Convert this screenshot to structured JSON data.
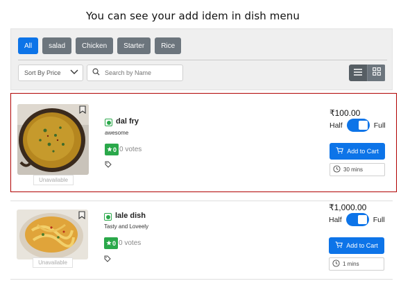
{
  "caption": "You can see your add idem in dish menu",
  "filters": {
    "categories": [
      {
        "label": "All",
        "active": true
      },
      {
        "label": "salad",
        "active": false
      },
      {
        "label": "Chicken",
        "active": false
      },
      {
        "label": "Starter",
        "active": false
      },
      {
        "label": "Rice",
        "active": false
      }
    ],
    "sort_label": "Sort By Price",
    "search_placeholder": "Search by Name",
    "view_modes": [
      "list-view",
      "grid-view"
    ],
    "active_view": "list-view"
  },
  "dishes": [
    {
      "name": "dal fry",
      "description": "awesome",
      "rating": "0",
      "votes": "0 votes",
      "price": "₹100.00",
      "portion_left": "Half",
      "portion_right": "Full",
      "add_label": "Add to Cart",
      "time": "30 mins",
      "status": "Unavailable",
      "veg": true
    },
    {
      "name": "lale dish",
      "description": "Tasty and Loveely",
      "rating": "0",
      "votes": "0 votes",
      "price": "₹1,000.00",
      "portion_left": "Half",
      "portion_right": "Full",
      "add_label": "Add to Cart",
      "time": "1 mins",
      "status": "Unavailable",
      "veg": true
    }
  ],
  "colors": {
    "primary": "#0d74e8",
    "secondary": "#6c757d",
    "veg": "#2aa84a",
    "highlight_border": "#b00000"
  }
}
